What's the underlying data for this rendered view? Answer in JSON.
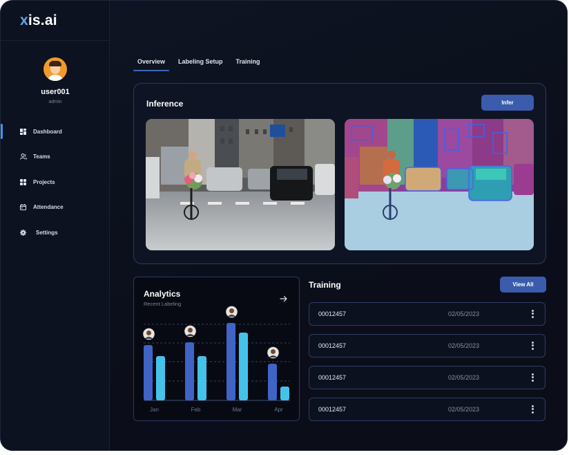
{
  "app": {
    "logo_prefix": "x",
    "logo_rest": "is.ai"
  },
  "user": {
    "name": "user001",
    "role": "admin"
  },
  "nav": [
    {
      "label": "Dashboard",
      "icon": "grid-icon",
      "active": true
    },
    {
      "label": "Teams",
      "icon": "users-icon"
    },
    {
      "label": "Projects",
      "icon": "apps-icon"
    },
    {
      "label": "Attendance",
      "icon": "calendar-icon"
    },
    {
      "label": "Settings",
      "icon": "gear-icon"
    }
  ],
  "tabs": [
    {
      "label": "Overview",
      "active": true
    },
    {
      "label": "Labeling Setup"
    },
    {
      "label": "Training"
    }
  ],
  "inference": {
    "title": "Inference",
    "button": "Infer",
    "images": [
      "original-street-photo",
      "segmentation-overlay-photo"
    ]
  },
  "analytics": {
    "title": "Analytics",
    "subtitle": "Recent Labeling",
    "arrow_icon": "arrow-right-icon"
  },
  "chart_data": {
    "type": "bar",
    "categories": [
      "Jan",
      "Feb",
      "Mar",
      "Apr"
    ],
    "series": [
      {
        "values": [
          80,
          84,
          112,
          53
        ],
        "color": "#3f64c6"
      },
      {
        "values": [
          64,
          64,
          98,
          20
        ],
        "color": "#45c2ea"
      }
    ],
    "grid": "dashed horizontal",
    "markers": "avatar above first bar of each group"
  },
  "training": {
    "title": "Training",
    "button": "View All",
    "rows": [
      {
        "id": "00012457",
        "date": "02/05/2023"
      },
      {
        "id": "00012457",
        "date": "02/05/2023"
      },
      {
        "id": "00012457",
        "date": "02/05/2023"
      },
      {
        "id": "00012457",
        "date": "02/05/2023"
      }
    ]
  },
  "colors": {
    "accent": "#3b5cad",
    "bar_dark": "#3f64c6",
    "bar_light": "#45c2ea",
    "card_border": "#2a3a62"
  }
}
